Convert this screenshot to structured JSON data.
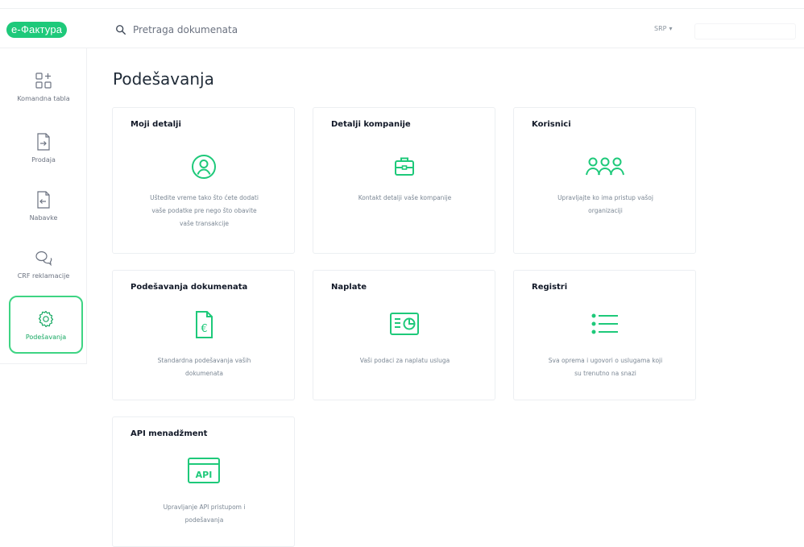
{
  "header": {
    "logo_text": "e-Фактура",
    "search_placeholder": "Pretraga dokumenata",
    "language": "SRP",
    "language_caret": "▾"
  },
  "sidebar": {
    "items": [
      {
        "label": "Komandna tabla",
        "icon": "dashboard-icon",
        "active": false
      },
      {
        "label": "Prodaja",
        "icon": "outgoing-document-icon",
        "active": false
      },
      {
        "label": "Nabavke",
        "icon": "incoming-document-icon",
        "active": false
      },
      {
        "label": "CRF reklamacije",
        "icon": "chat-bubbles-icon",
        "active": false
      },
      {
        "label": "Podešavanja",
        "icon": "gear-icon",
        "active": true
      }
    ]
  },
  "main": {
    "title": "Podešavanja",
    "cards": [
      {
        "title": "Moji detalji",
        "icon": "user-icon",
        "description_lines": [
          "Uštedite vreme tako što ćete dodati",
          "vaše podatke pre nego što obavite",
          "vaše transakcije"
        ]
      },
      {
        "title": "Detalji kompanije",
        "icon": "briefcase-icon",
        "description_lines": [
          "Kontakt detalji vaše kompanije"
        ]
      },
      {
        "title": "Korisnici",
        "icon": "users-icon",
        "description_lines": [
          "Upravljajte ko ima pristup vašoj",
          "organizaciji"
        ]
      },
      {
        "title": "Podešavanja dokumenata",
        "icon": "euro-document-icon",
        "description_lines": [
          "Standardna podešavanja vaših",
          "dokumenata"
        ]
      },
      {
        "title": "Naplate",
        "icon": "billing-icon",
        "description_lines": [
          "Vaši podaci za naplatu usluga"
        ]
      },
      {
        "title": "Registri",
        "icon": "list-icon",
        "description_lines": [
          "Sva oprema i ugovori o uslugama koji",
          "su trenutno na snazi"
        ]
      },
      {
        "title": "API menadžment",
        "icon": "api-icon",
        "icon_text": "API",
        "description_lines": [
          "Upravljanje API pristupom i",
          "podešavanja"
        ]
      }
    ]
  },
  "colors": {
    "accent": "#1ec97a",
    "active_border": "#3ed483"
  }
}
